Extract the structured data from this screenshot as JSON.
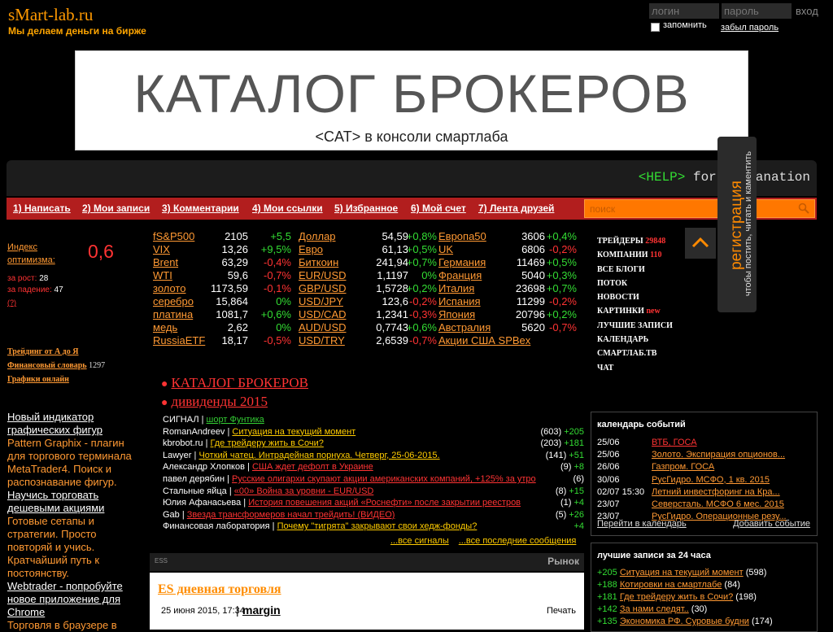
{
  "header": {
    "logo": "sMart-lab.ru",
    "tagline": "Мы делаем деньги на бирже",
    "login_placeholder": "логин",
    "password_placeholder": "пароль",
    "login_button": "вход",
    "remember": "запомнить",
    "forgot": "забыл пароль"
  },
  "banner": {
    "title": "КАТАЛОГ БРОКЕРОВ",
    "subtitle": "<CAT> в консоли смартлаба"
  },
  "console": {
    "help": "<HELP>",
    "text": " for explanation"
  },
  "menu": {
    "items": [
      "1) Написать",
      "2) Мои записи",
      "3) Комментарии",
      "4) Мои ссылки",
      "5) Избранное",
      "6) Мой счет",
      "7) Лента друзей"
    ],
    "search_placeholder": "поиск"
  },
  "registration": {
    "title": "регистрация",
    "subtitle": "чтобы постить, читать и каментить"
  },
  "optimism": {
    "label_line1": "Индекс",
    "label_line2": "оптимизма:",
    "value": "0,6",
    "growth_label": "за рост:",
    "growth_value": "28",
    "fall_label": "за падение:",
    "fall_value": "47",
    "help": "(?)"
  },
  "left_links": {
    "trading": "Трейдинг от А до Я",
    "dictionary": "Финансовый словарь",
    "dictionary_count": "1297",
    "charts": "Графики онлайн"
  },
  "left_articles": [
    {
      "title": "Новый индикатор графических фигур",
      "text": "Pattern Graphix - плагин для торгового терминала MetaTrader4. Поиск и распознавание фигур."
    },
    {
      "title": "Научись торговать дешевыми акциями",
      "text": "Готовые сетапы и стратегии. Просто повторяй и учись. Кратчайший путь к постоянству."
    },
    {
      "title": "Webtrader - попробуйте новое приложение для Chrome",
      "text": "Торговля в браузере в"
    }
  ],
  "quotes": {
    "col1": [
      {
        "name": "fS&P500",
        "value": "2105",
        "change": "+5,5",
        "dir": "up"
      },
      {
        "name": "VIX",
        "value": "13,26",
        "change": "+9,5%",
        "dir": "up"
      },
      {
        "name": "Brent",
        "value": "63,29",
        "change": "-0,4%",
        "dir": "down"
      },
      {
        "name": "WTI",
        "value": "59,6",
        "change": "-0,7%",
        "dir": "down"
      },
      {
        "name": "золото",
        "value": "1173,59",
        "change": "-0,1%",
        "dir": "down"
      },
      {
        "name": "серебро",
        "value": "15,864",
        "change": "0%",
        "dir": "zero"
      },
      {
        "name": "платина",
        "value": "1081,7",
        "change": "+0,6%",
        "dir": "up"
      },
      {
        "name": "медь",
        "value": "2,62",
        "change": "0%",
        "dir": "zero"
      },
      {
        "name": "RussiaETF",
        "value": "18,17",
        "change": "-0,5%",
        "dir": "down"
      }
    ],
    "col2": [
      {
        "name": "Доллар",
        "value": "54,59",
        "change": "+0,8%",
        "dir": "up"
      },
      {
        "name": "Евро",
        "value": "61,13",
        "change": "+0,5%",
        "dir": "up"
      },
      {
        "name": "Биткоин",
        "value": "241,94",
        "change": "+0,7%",
        "dir": "up"
      },
      {
        "name": "EUR/USD",
        "value": "1,1197",
        "change": "0%",
        "dir": "zero"
      },
      {
        "name": "GBP/USD",
        "value": "1,5728",
        "change": "+0,2%",
        "dir": "up"
      },
      {
        "name": "USD/JPY",
        "value": "123,6",
        "change": "-0,2%",
        "dir": "down"
      },
      {
        "name": "USD/CAD",
        "value": "1,2341",
        "change": "-0,3%",
        "dir": "down"
      },
      {
        "name": "AUD/USD",
        "value": "0,7743",
        "change": "+0,6%",
        "dir": "up"
      },
      {
        "name": "USD/TRY",
        "value": "2,6539",
        "change": "-0,7%",
        "dir": "down"
      }
    ],
    "col3": [
      {
        "name": "Европа50",
        "value": "3606",
        "change": "+0,4%",
        "dir": "up"
      },
      {
        "name": "UK",
        "value": "6806",
        "change": "-0,2%",
        "dir": "down"
      },
      {
        "name": "Германия",
        "value": "11469",
        "change": "+0,5%",
        "dir": "up"
      },
      {
        "name": "Франция",
        "value": "5040",
        "change": "+0,3%",
        "dir": "up"
      },
      {
        "name": "Италия",
        "value": "23698",
        "change": "+0,7%",
        "dir": "up"
      },
      {
        "name": "Испания",
        "value": "11299",
        "change": "-0,2%",
        "dir": "down"
      },
      {
        "name": "Япония",
        "value": "20796",
        "change": "+0,2%",
        "dir": "up"
      },
      {
        "name": "Австралия",
        "value": "5620",
        "change": "-0,7%",
        "dir": "down"
      },
      {
        "name": "Акции США SPBex",
        "value": "",
        "change": "",
        "dir": "zero"
      }
    ]
  },
  "right_menu": [
    {
      "label": "ТРЕЙДЕРЫ",
      "count": "29848"
    },
    {
      "label": "КОМПАНИИ",
      "count": "110"
    },
    {
      "label": "ВСЕ БЛОГИ",
      "count": ""
    },
    {
      "label": "ПОТОК",
      "count": ""
    },
    {
      "label": "НОВОСТИ",
      "count": ""
    },
    {
      "label": "КАРТИНКИ",
      "count": "new"
    },
    {
      "label": "ЛУЧШИЕ ЗАПИСИ",
      "count": ""
    },
    {
      "label": "КАЛЕНДАРЬ",
      "count": ""
    },
    {
      "label": "СМАРТЛАБ.ТВ",
      "count": ""
    },
    {
      "label": "ЧАТ",
      "count": ""
    }
  ],
  "catalog_links": [
    "КАТАЛОГ БРОКЕРОВ",
    "дивиденды 2015"
  ],
  "signals": [
    {
      "author": "СИГНАЛ",
      "title": "шорт Фунтика",
      "title_color": "#33cc33",
      "count": "",
      "plus": ""
    },
    {
      "author": "RomanAndreev",
      "title": "Ситуация на текущий момент",
      "title_color": "",
      "count": "(603)",
      "plus": "+205"
    },
    {
      "author": "kbrobot.ru",
      "title": "Где трейдеру жить в Сочи?",
      "title_color": "",
      "count": "(203)",
      "plus": "+181"
    },
    {
      "author": "Lawyer",
      "title": "Чоткий чатец. Интрадейная порнуха. Четверг, 25-06-2015.",
      "title_color": "",
      "count": "(141)",
      "plus": "+51"
    },
    {
      "author": "Александр Хлопков",
      "title": "США ждет дефолт в Украине",
      "title_color": "#ff3333",
      "count": "(9)",
      "plus": "+8"
    },
    {
      "author": "павел дерябин",
      "title": "Русские олигархи скупают акции американских компаний, +125% за утро",
      "title_color": "#ff3333",
      "count": "(6)",
      "plus": ""
    },
    {
      "author": "Стальные яйца",
      "title": "«00» Война за уровни - EUR/USD",
      "title_color": "#ff3333",
      "count": "(8)",
      "plus": "+15"
    },
    {
      "author": "Юлия Афанасьева",
      "title": "История повешения акций «Роснефти» после закрытии реестров",
      "title_color": "#ff3333",
      "count": "(1)",
      "plus": "+4"
    },
    {
      "author": "Gab",
      "title": "Звезда трансформеров начал трейдить! (ВИДЕО)",
      "title_color": "#ff3333",
      "count": "(5)",
      "plus": "+26"
    },
    {
      "author": "Финансовая лаборатория",
      "title": "Почему \"тигрята\" закрывают свои хедж-фонды?",
      "title_color": "",
      "count": "",
      "plus": "+4"
    }
  ],
  "signals_more": {
    "all_signals": "...все сигналы",
    "all_posts": "...все последние сообщения"
  },
  "feed": {
    "tag": "ESS",
    "market": "Рынок",
    "post_title": "ES дневная торговля",
    "post_date": "25 июня 2015, 17:34",
    "post_author": "margin",
    "print": "Печать"
  },
  "calendar": {
    "title": "календарь событий",
    "events": [
      {
        "date": "25/06",
        "event": "ВТБ, ГОСА",
        "red": true
      },
      {
        "date": "25/06",
        "event": "Золото. Экспирация опционов...",
        "red": false
      },
      {
        "date": "26/06",
        "event": "Газпром. ГОСА",
        "red": false
      },
      {
        "date": "30/06",
        "event": "РусГидро. МСФО, 1 кв. 2015",
        "red": false
      },
      {
        "date": "02/07 15:30",
        "event": "Летний инвестфоринг на Кра...",
        "red": false
      },
      {
        "date": "23/07",
        "event": "Северсталь. МСФО 6 мес. 2015",
        "red": false
      },
      {
        "date": "23/07",
        "event": "РусГидро. Операционные резу...",
        "red": false
      }
    ],
    "go": "Перейти в календарь",
    "add": "Добавить событие"
  },
  "best": {
    "title": "лучшие записи за 24 часа",
    "items": [
      {
        "plus": "+205",
        "title": "Ситуация на текущий момент",
        "count": "(598)"
      },
      {
        "plus": "+188",
        "title": "Котировки на смартлабе",
        "count": "(84)"
      },
      {
        "plus": "+181",
        "title": "Где трейдеру жить в Сочи?",
        "count": "(198)"
      },
      {
        "plus": "+142",
        "title": "За нами следят..",
        "count": "(30)"
      },
      {
        "plus": "+135",
        "title": "Экономика РФ. Суровые будни",
        "count": "(174)"
      }
    ]
  },
  "colors": {
    "accent_orange": "#ff9933",
    "menu_red": "#b21e1e",
    "up_green": "#33dd33",
    "down_red": "#ff3333"
  }
}
